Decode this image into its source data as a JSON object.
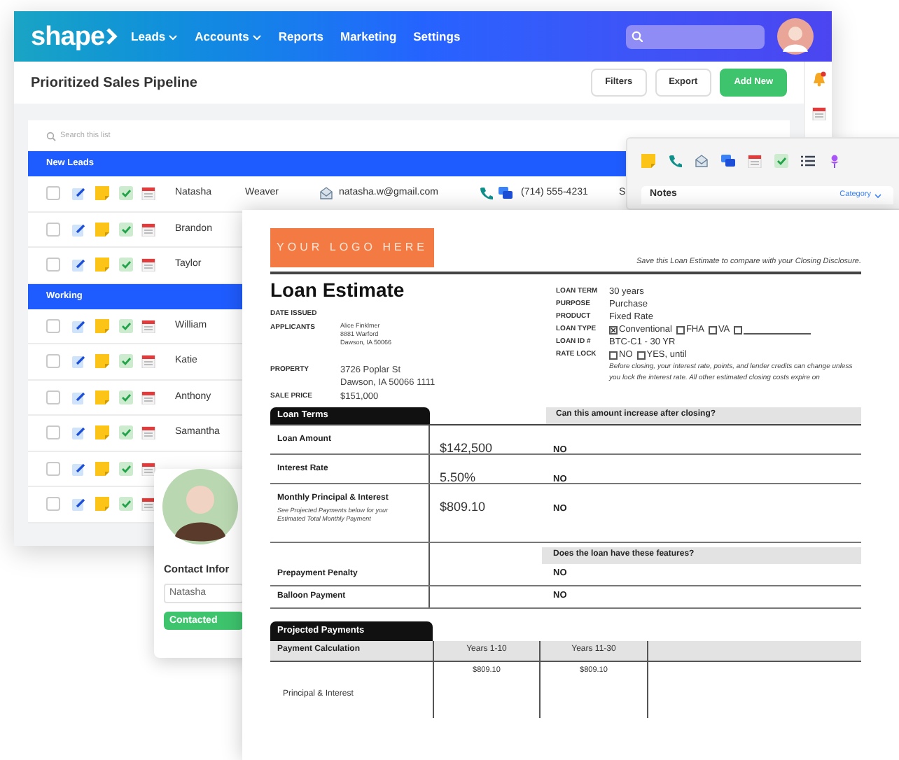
{
  "header": {
    "logo": "shape",
    "nav": [
      {
        "label": "Leads",
        "dropdown": true
      },
      {
        "label": "Accounts",
        "dropdown": true
      },
      {
        "label": "Reports",
        "dropdown": false
      },
      {
        "label": "Marketing",
        "dropdown": false
      },
      {
        "label": "Settings",
        "dropdown": false
      }
    ]
  },
  "toolbar": {
    "title": "Prioritized Sales Pipeline",
    "buttons": [
      {
        "label": "Filters",
        "kind": "outline"
      },
      {
        "label": "Export",
        "kind": "outline"
      },
      {
        "label": "Add New",
        "kind": "primary"
      }
    ]
  },
  "list": {
    "placeholder": "Search this list",
    "groups": [
      {
        "name": "New Leads",
        "rows": [
          {
            "checked": false,
            "first_name": "Natasha",
            "last_name": "Weaver",
            "email": "natasha.w@gmail.com",
            "phone": "(714) 555-4231",
            "column_6": "S"
          },
          {
            "checked": false,
            "first_name": "Brandon"
          },
          {
            "checked": false,
            "first_name": "Taylor"
          }
        ]
      },
      {
        "name": "Working",
        "rows": [
          {
            "checked": false,
            "first_name": "William"
          },
          {
            "checked": false,
            "first_name": "Katie"
          },
          {
            "checked": false,
            "first_name": "Anthony"
          },
          {
            "checked": false,
            "first_name": "Samantha"
          },
          {
            "checked": false
          },
          {
            "checked": false
          }
        ]
      }
    ]
  },
  "quick_panel": {
    "title": "Notes",
    "category": "Category"
  },
  "contact_card": {
    "heading": "Contact Infor",
    "first_name": "Natasha",
    "status": "Contacted"
  },
  "document": {
    "logo": "YOUR LOGO HERE",
    "note": "Save this Loan Estimate to compare with your Closing Disclosure.",
    "title": "Loan Estimate",
    "left_fields": [
      {
        "label": "DATE ISSUED"
      },
      {
        "label": "APPLICANTS",
        "lines": [
          "Alice Finklmer",
          "8881 Warford",
          "Dawson, IA 50066"
        ]
      },
      {
        "label": "PROPERTY",
        "lines": [
          "3726 Poplar St",
          "Dawson, IA 50066 1111"
        ]
      },
      {
        "label": "SALE PRICE",
        "lines": [
          "$151,000"
        ]
      }
    ],
    "right_fields": [
      {
        "label": "LOAN TERM",
        "kind": "text",
        "value": "30 years"
      },
      {
        "label": "PURPOSE",
        "kind": "text",
        "value": "Purchase"
      },
      {
        "label": "PRODUCT",
        "kind": "text",
        "value": "Fixed Rate"
      },
      {
        "label": "LOAN TYPE",
        "kind": "options",
        "options": [
          {
            "label": "Conventional",
            "checked": true
          },
          {
            "label": "FHA",
            "checked": false
          },
          {
            "label": "VA",
            "checked": false
          },
          {
            "checked": false
          }
        ]
      },
      {
        "label": "LOAN ID #",
        "kind": "text",
        "value": "BTC-C1 - 30 YR"
      },
      {
        "label": "RATE LOCK",
        "kind": "options",
        "options": [
          {
            "label": "NO",
            "checked": false
          },
          {
            "label": "YES, until",
            "checked": false
          }
        ]
      }
    ],
    "rate_note": "Before closing, your interest rate, points, and lender credits can change unless you lock the interest rate. All other estimated closing costs expire on",
    "loan_terms": {
      "title": "Loan Terms",
      "question": "Can this amount increase after closing?",
      "rows": [
        {
          "label": "Loan Amount",
          "value": "$142,500",
          "answer": "NO"
        },
        {
          "label": "Interest Rate",
          "value": "5.50%",
          "answer": "NO"
        },
        {
          "label": "Monthly Principal & Interest",
          "note": "See Projected Payments below for your Estimated Total Monthly Payment",
          "value": "$809.10",
          "answer": "NO"
        }
      ],
      "features_question": "Does the loan have these features?",
      "features": [
        {
          "label": "Prepayment Penalty",
          "answer": "NO"
        },
        {
          "label": "Balloon Payment",
          "answer": "NO"
        }
      ]
    },
    "projected_payments": {
      "title": "Projected Payments",
      "columns": [
        "Payment Calculation",
        "Years 1-10",
        "Years 11-30"
      ],
      "rows": [
        {
          "label": "Principal & Interest",
          "values": [
            "$809.10",
            "$809.10"
          ]
        }
      ]
    }
  }
}
